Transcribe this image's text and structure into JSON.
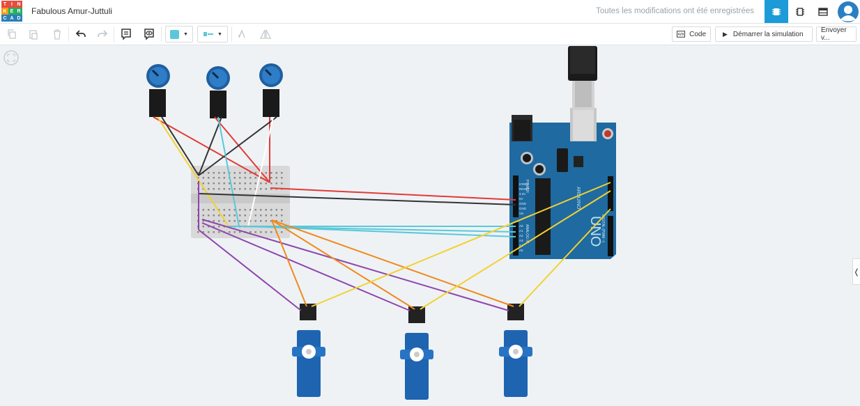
{
  "app": {
    "logo_letters": [
      "T",
      "I",
      "N",
      "K",
      "E",
      "R",
      "C",
      "A",
      "D"
    ],
    "project_title": "Fabulous Amur-Juttuli",
    "status": "Toutes les modifications ont été enregistrées"
  },
  "toolbar": {
    "code_label": "Code",
    "simulate_label": "Démarrer la simulation",
    "send_label": "Envoyer v..."
  },
  "colors": {
    "accent": "#1d9bd8",
    "logo": [
      "#e74c3c",
      "#e74c3c",
      "#e74c3c",
      "#f39c12",
      "#27ae60",
      "#27ae60",
      "#2980b9",
      "#2980b9",
      "#2980b9"
    ],
    "wire_red": "#e53935",
    "wire_black": "#333333",
    "wire_yellow": "#f2d230",
    "wire_blue": "#5bc8d9",
    "wire_orange": "#f08a1c",
    "wire_purple": "#8e44ad"
  },
  "arduino": {
    "board_label": "UNO",
    "brand_label": "ARDUINO",
    "power_pins": [
      "IOREF",
      "RESET",
      "3.3V",
      "5V",
      "GND",
      "GND",
      "Vin"
    ],
    "analog_pins": [
      "A0",
      "A1",
      "A2",
      "A3",
      "A4",
      "A5"
    ],
    "section_power": "POWER",
    "section_analog": "ANALOG IN",
    "section_digital": "DIGITAL (PWM ~)"
  },
  "icons": {
    "undo": "undo-icon",
    "redo": "redo-icon",
    "fit": "fit-view-icon"
  }
}
